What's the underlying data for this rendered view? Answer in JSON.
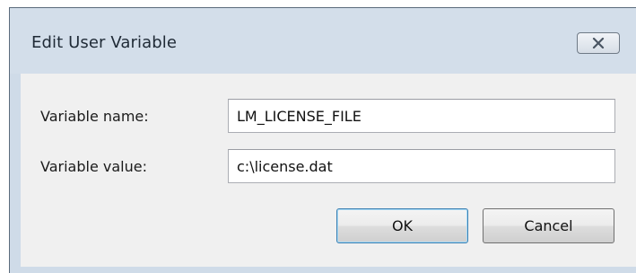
{
  "window": {
    "title": "Edit User Variable",
    "close_icon": "close-icon"
  },
  "form": {
    "name_label": "Variable name:",
    "name_value": "LM_LICENSE_FILE",
    "value_label": "Variable value:",
    "value_value": "c:\\license.dat"
  },
  "buttons": {
    "ok_label": "OK",
    "cancel_label": "Cancel"
  },
  "colors": {
    "frame": "#cfdbe8",
    "client": "#f0f0f0",
    "default_button_border": "#3c7fb1"
  }
}
